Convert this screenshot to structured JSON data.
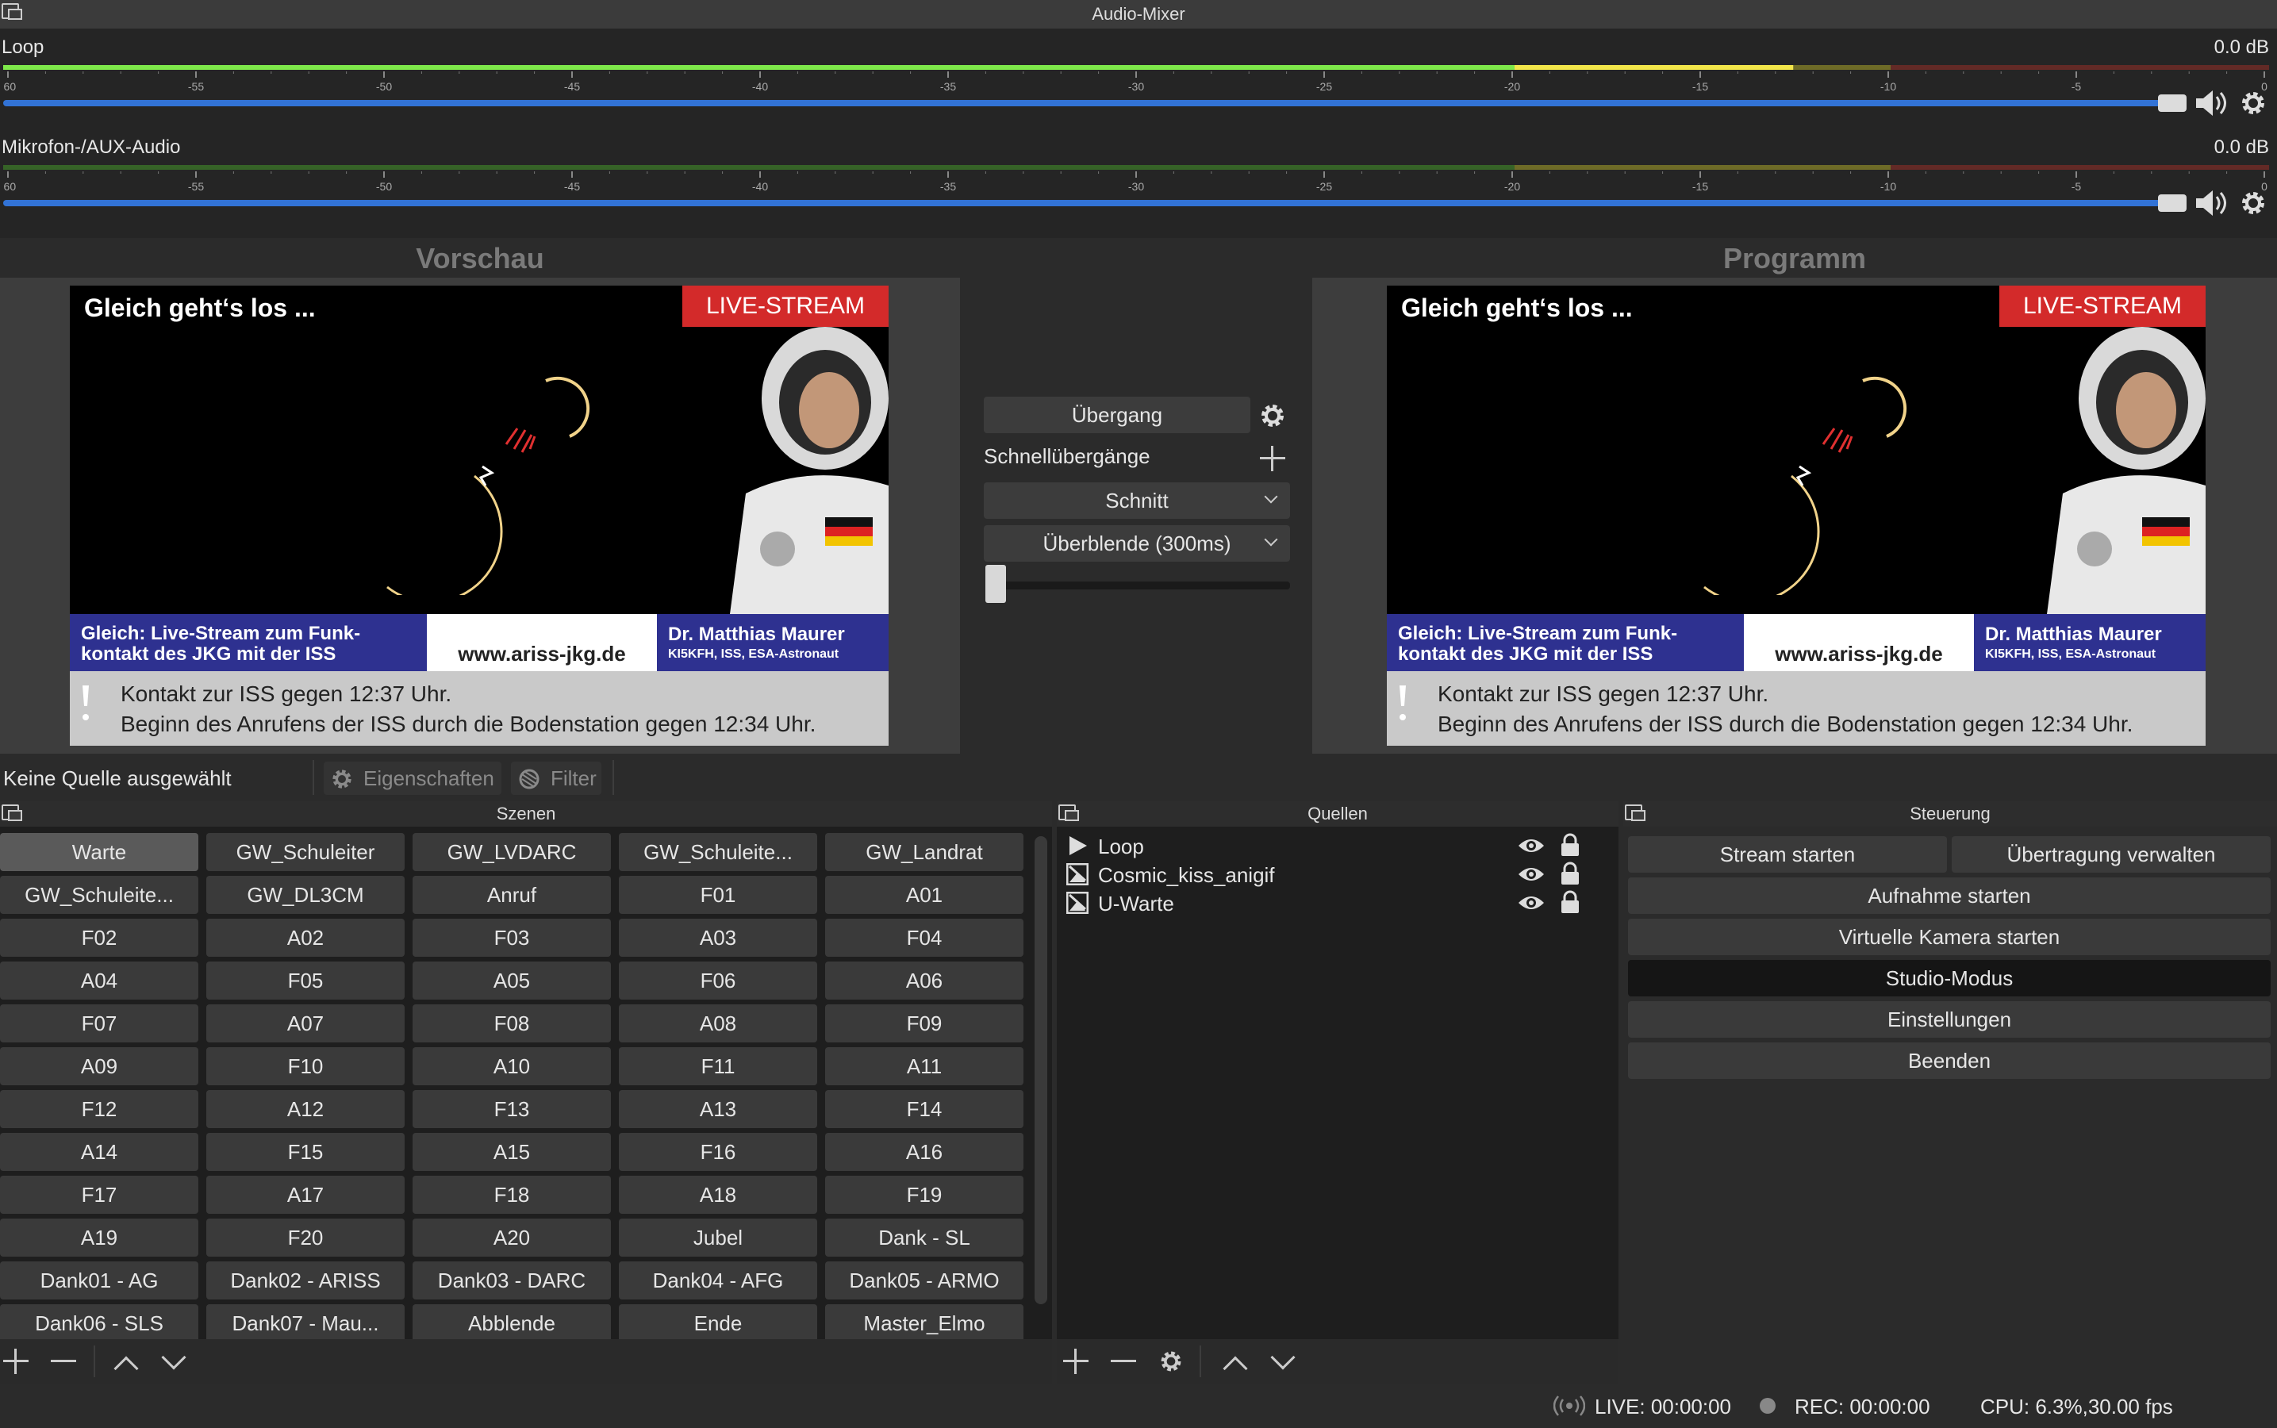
{
  "mixer": {
    "title": "Audio-Mixer",
    "ticks": [
      "-60",
      "-55",
      "-50",
      "-45",
      "-40",
      "-35",
      "-30",
      "-25",
      "-20",
      "-15",
      "-10",
      "-5",
      "0"
    ],
    "channels": [
      {
        "name": "Loop",
        "db": "0.0 dB",
        "level": 0.79
      },
      {
        "name": "Mikrofon-/AUX-Audio",
        "db": "0.0 dB",
        "level": 0.0
      }
    ]
  },
  "preview": {
    "title": "Vorschau"
  },
  "program": {
    "title": "Programm"
  },
  "stream": {
    "headline": "Gleich geht‘s los ...",
    "live": "LIVE-STREAM",
    "bar_left_1": "Gleich: Live-Stream zum Funk-",
    "bar_left_2": "kontakt des JKG mit der ISS",
    "url": "www.ariss-jkg.de",
    "person": "Dr. Matthias Maurer",
    "person_sub": "KI5KFH, ISS, ESA-Astronaut",
    "ticker_1": "Kontakt zur ISS gegen 12:37 Uhr.",
    "ticker_2": "Beginn des Anrufens der ISS durch die Bodenstation gegen 12:34 Uhr."
  },
  "transition": {
    "button": "Übergang",
    "quick_label": "Schnellübergänge",
    "cut": "Schnitt",
    "fade": "Überblende (300ms)",
    "progress": 0.0
  },
  "source_toolbar": {
    "label": "Keine Quelle ausgewählt",
    "properties": "Eigenschaften",
    "filter": "Filter"
  },
  "scenes": {
    "title": "Szenen",
    "items": [
      "Warte",
      "GW_Schuleiter",
      "GW_LVDARC",
      "GW_Schuleite...",
      "GW_Landrat",
      "GW_Schuleite...",
      "GW_DL3CM",
      "Anruf",
      "F01",
      "A01",
      "F02",
      "A02",
      "F03",
      "A03",
      "F04",
      "A04",
      "F05",
      "A05",
      "F06",
      "A06",
      "F07",
      "A07",
      "F08",
      "A08",
      "F09",
      "A09",
      "F10",
      "A10",
      "F11",
      "A11",
      "F12",
      "A12",
      "F13",
      "A13",
      "F14",
      "A14",
      "F15",
      "A15",
      "F16",
      "A16",
      "F17",
      "A17",
      "F18",
      "A18",
      "F19",
      "A19",
      "F20",
      "A20",
      "Jubel",
      "Dank - SL",
      "Dank01 - AG",
      "Dank02 - ARISS",
      "Dank03 - DARC",
      "Dank04 - AFG",
      "Dank05 - ARMO",
      "Dank06 - SLS",
      "Dank07 - Mau...",
      "Abblende",
      "Ende",
      "Master_Elmo"
    ]
  },
  "sources": {
    "title": "Quellen",
    "items": [
      {
        "name": "Loop",
        "type": "media-source-icon"
      },
      {
        "name": "Cosmic_kiss_anigif",
        "type": "image-source-icon"
      },
      {
        "name": "U-Warte",
        "type": "image-source-icon"
      }
    ]
  },
  "controls": {
    "title": "Steuerung",
    "stream_start": "Stream starten",
    "broadcast_manage": "Übertragung verwalten",
    "record_start": "Aufnahme starten",
    "virtual_cam": "Virtuelle Kamera starten",
    "studio_mode": "Studio-Modus",
    "settings": "Einstellungen",
    "exit": "Beenden"
  },
  "status": {
    "live": "LIVE: 00:00:00",
    "rec": "REC: 00:00:00",
    "cpu": "CPU: 6.3%,30.00 fps"
  },
  "colors": {
    "accent_blue": "#3273d6",
    "live_red": "#d32a2a",
    "banner_blue": "#2e3190",
    "meter_green": "#4caf2a",
    "meter_yellow": "#c8c22a",
    "meter_red": "#b03028"
  }
}
